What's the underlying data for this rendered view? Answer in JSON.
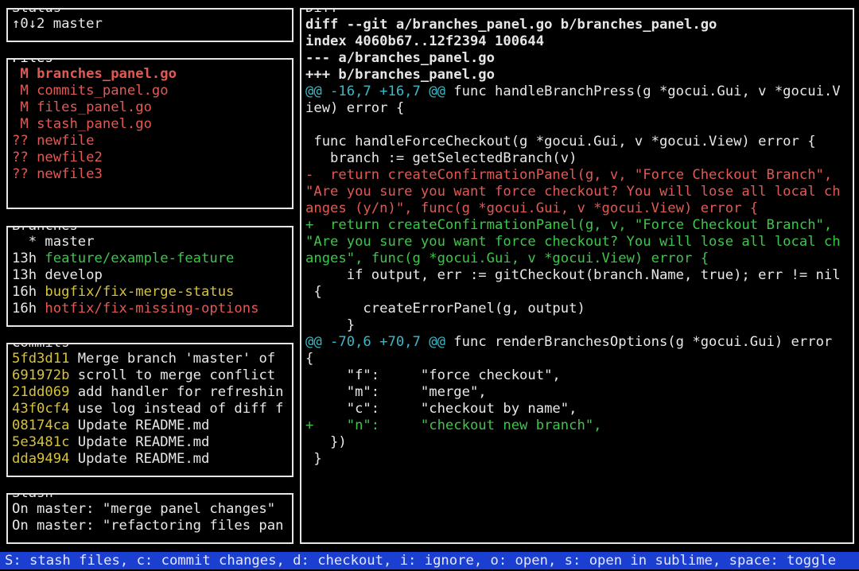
{
  "status": {
    "title": "Status",
    "text": "↑0↓2 master"
  },
  "files": {
    "title": "Files",
    "items": [
      {
        "code": " M",
        "name": "branches_panel.go",
        "color": "#e05a55",
        "selected": true
      },
      {
        "code": " M",
        "name": "commits_panel.go",
        "color": "#e05a55",
        "selected": false
      },
      {
        "code": " M",
        "name": "files_panel.go",
        "color": "#e05a55",
        "selected": false
      },
      {
        "code": " M",
        "name": "stash_panel.go",
        "color": "#e05a55",
        "selected": false
      },
      {
        "code": "??",
        "name": "newfile",
        "color": "#e05a55",
        "selected": false
      },
      {
        "code": "??",
        "name": "newfile2",
        "color": "#e05a55",
        "selected": false
      },
      {
        "code": "??",
        "name": "newfile3",
        "color": "#e05a55",
        "selected": false
      }
    ]
  },
  "branches": {
    "title": "Branches",
    "items": [
      {
        "age": "  *",
        "name": "master",
        "color": "#e8e8e8"
      },
      {
        "age": "13h",
        "name": "feature/example-feature",
        "color": "#3fc44c"
      },
      {
        "age": "13h",
        "name": "develop",
        "color": "#e8e8e8"
      },
      {
        "age": "16h",
        "name": "bugfix/fix-merge-status",
        "color": "#d7c23c"
      },
      {
        "age": "16h",
        "name": "hotfix/fix-missing-options",
        "color": "#e05a55"
      }
    ]
  },
  "commits": {
    "title": "Commits",
    "items": [
      {
        "hash": "5fd3d11",
        "message": "Merge branch 'master' of"
      },
      {
        "hash": "691972b",
        "message": "scroll to merge conflict"
      },
      {
        "hash": "21dd069",
        "message": "add handler for refreshin"
      },
      {
        "hash": "43f0cf4",
        "message": "use log instead of diff f"
      },
      {
        "hash": "08174ca",
        "message": "Update README.md"
      },
      {
        "hash": "5e3481c",
        "message": "Update README.md"
      },
      {
        "hash": "dda9494",
        "message": "Update README.md"
      }
    ]
  },
  "stash": {
    "title": "Stash",
    "items": [
      {
        "text": "On master: \"merge panel changes\""
      },
      {
        "text": "On master: \"refactoring files pan"
      }
    ]
  },
  "diff": {
    "title": "Diff",
    "lines": [
      {
        "text": "diff --git a/branches_panel.go b/branches_panel.go",
        "kind": "header"
      },
      {
        "text": "index 4060b67..12f2394 100644",
        "kind": "header"
      },
      {
        "text": "--- a/branches_panel.go",
        "kind": "header"
      },
      {
        "text": "+++ b/branches_panel.go",
        "kind": "header"
      },
      {
        "text": "@@ -16,7 +16,7 @@",
        "kind": "hunk",
        "rest": " func handleBranchPress(g *gocui.Gui, v *gocui.V"
      },
      {
        "text": "iew) error {",
        "kind": "context"
      },
      {
        "text": "",
        "kind": "context"
      },
      {
        "text": " func handleForceCheckout(g *gocui.Gui, v *gocui.View) error {",
        "kind": "context"
      },
      {
        "text": "   branch := getSelectedBranch(v)",
        "kind": "context"
      },
      {
        "text": "-  return createConfirmationPanel(g, v, \"Force Checkout Branch\",",
        "kind": "removed"
      },
      {
        "text": "\"Are you sure you want force checkout? You will lose all local ch",
        "kind": "removed"
      },
      {
        "text": "anges (y/n)\", func(g *gocui.Gui, v *gocui.View) error {",
        "kind": "removed"
      },
      {
        "text": "+  return createConfirmationPanel(g, v, \"Force Checkout Branch\",",
        "kind": "added"
      },
      {
        "text": "\"Are you sure you want force checkout? You will lose all local ch",
        "kind": "added"
      },
      {
        "text": "anges\", func(g *gocui.Gui, v *gocui.View) error {",
        "kind": "added"
      },
      {
        "text": "     if output, err := gitCheckout(branch.Name, true); err != nil",
        "kind": "context"
      },
      {
        "text": " {",
        "kind": "context"
      },
      {
        "text": "       createErrorPanel(g, output)",
        "kind": "context"
      },
      {
        "text": "     }",
        "kind": "context"
      },
      {
        "text": "@@ -70,6 +70,7 @@",
        "kind": "hunk",
        "rest": " func renderBranchesOptions(g *gocui.Gui) error"
      },
      {
        "text": "{",
        "kind": "context"
      },
      {
        "text": "     \"f\":     \"force checkout\",",
        "kind": "context"
      },
      {
        "text": "     \"m\":     \"merge\",",
        "kind": "context"
      },
      {
        "text": "     \"c\":     \"checkout by name\",",
        "kind": "context"
      },
      {
        "text": "+    \"n\":     \"checkout new branch\",",
        "kind": "added"
      },
      {
        "text": "   })",
        "kind": "context"
      },
      {
        "text": " }",
        "kind": "context"
      }
    ]
  },
  "statusbar": {
    "text": "S: stash files, c: commit changes, d: checkout, i: ignore, o: open, s: open in sublime, space: toggle"
  },
  "colors": {
    "background": "#000000",
    "border": "#e6e6e6",
    "red": "#e05a55",
    "green": "#3fc44c",
    "yellow": "#d7c23c",
    "cyan": "#3cb9c6",
    "statusbar_bg": "#1a3fd1"
  }
}
